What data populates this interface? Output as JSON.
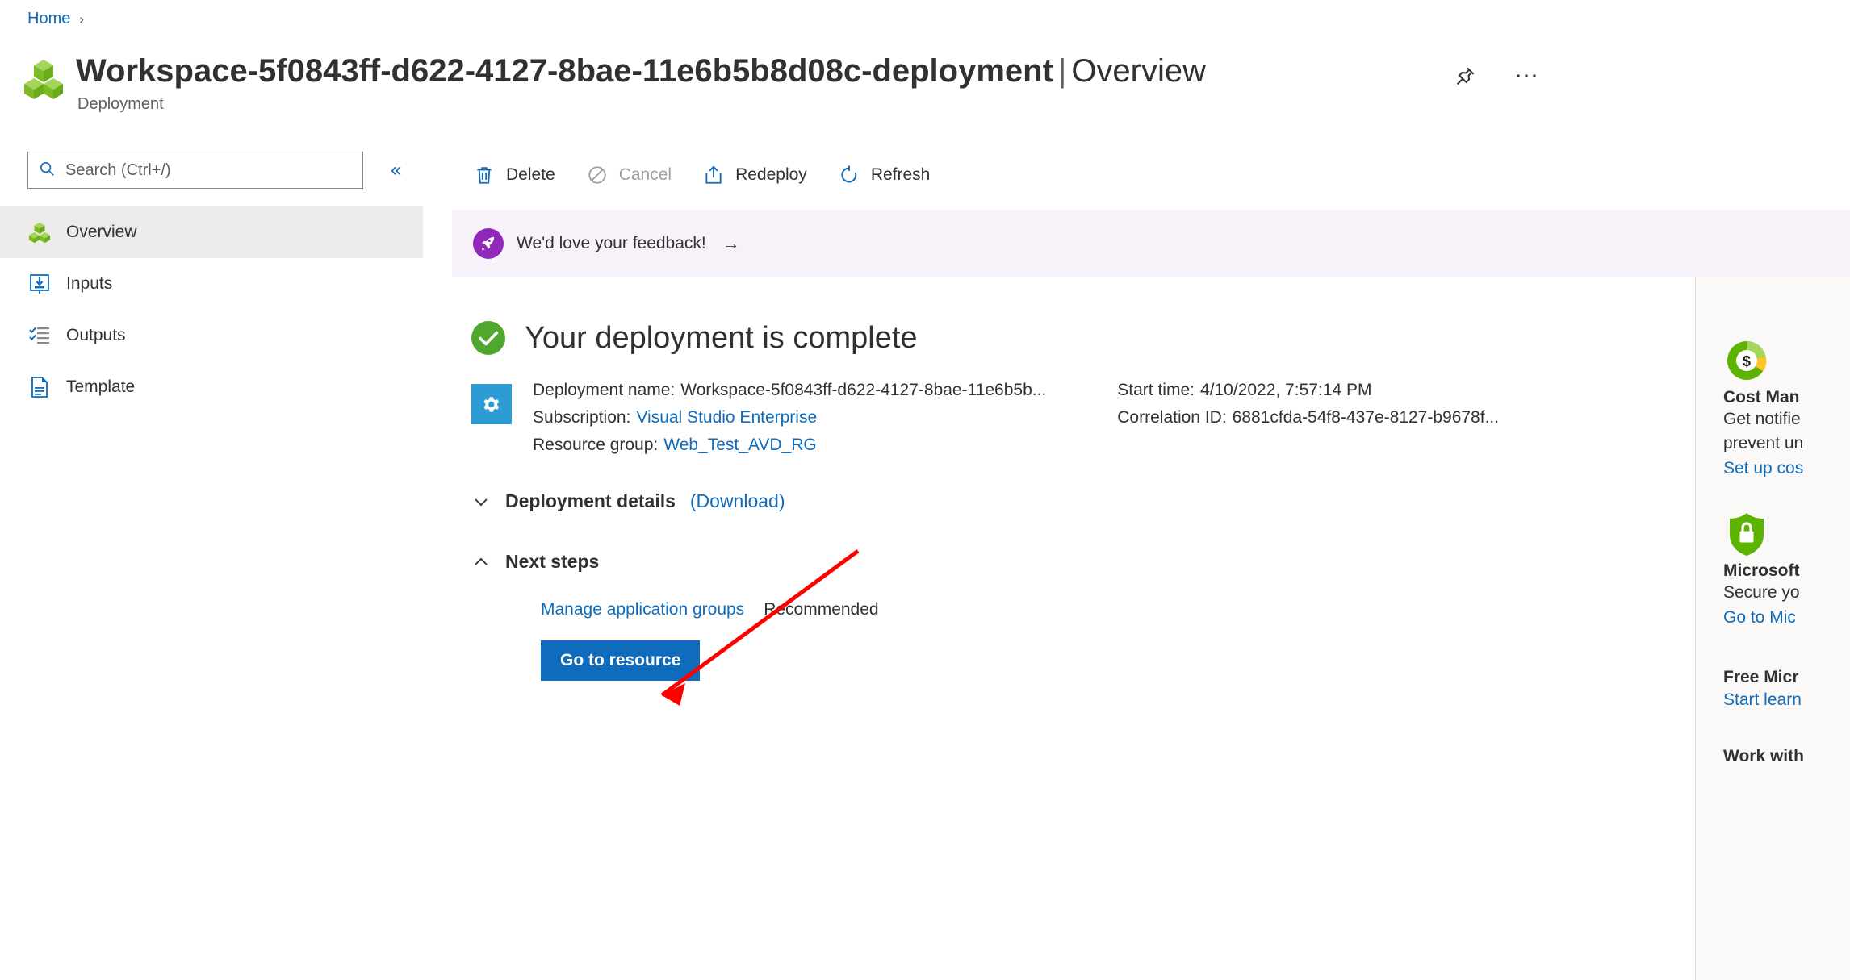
{
  "breadcrumb": {
    "home": "Home",
    "separator": "›"
  },
  "header": {
    "resource_icon": "cubes-icon",
    "title": "Workspace-5f0843ff-d622-4127-8bae-11e6b5b8d08c-deployment",
    "separator": "|",
    "view": "Overview",
    "subtitle": "Deployment",
    "pin_icon": "pin-icon",
    "more_icon": "ellipsis-icon"
  },
  "search": {
    "placeholder": "Search (Ctrl+/)",
    "value": "",
    "icon": "search-icon"
  },
  "collapse": {
    "glyph": "«"
  },
  "sidebar": {
    "items": [
      {
        "label": "Overview",
        "icon": "cubes-icon",
        "selected": true
      },
      {
        "label": "Inputs",
        "icon": "inputs-icon",
        "selected": false
      },
      {
        "label": "Outputs",
        "icon": "outputs-icon",
        "selected": false
      },
      {
        "label": "Template",
        "icon": "document-icon",
        "selected": false
      }
    ]
  },
  "toolbar": {
    "delete": {
      "label": "Delete",
      "icon": "trash-icon",
      "disabled": false
    },
    "cancel": {
      "label": "Cancel",
      "icon": "cancel-icon",
      "disabled": true
    },
    "redeploy": {
      "label": "Redeploy",
      "icon": "upload-icon",
      "disabled": false
    },
    "refresh": {
      "label": "Refresh",
      "icon": "refresh-icon",
      "disabled": false
    }
  },
  "feedback": {
    "text": "We'd love your feedback!",
    "arrow": "→",
    "icon": "rocket-icon"
  },
  "status": {
    "icon": "check-circle-icon",
    "title": "Your deployment is complete"
  },
  "details": {
    "icon": "deployment-icon",
    "deployment_name_label": "Deployment name:",
    "deployment_name_value": "Workspace-5f0843ff-d622-4127-8bae-11e6b5b...",
    "subscription_label": "Subscription:",
    "subscription_value": "Visual Studio Enterprise",
    "resource_group_label": "Resource group:",
    "resource_group_value": "Web_Test_AVD_RG",
    "start_time_label": "Start time:",
    "start_time_value": "4/10/2022, 7:57:14 PM",
    "correlation_id_label": "Correlation ID:",
    "correlation_id_value": "6881cfda-54f8-437e-8127-b9678f..."
  },
  "deployment_details": {
    "title": "Deployment details",
    "download_label": "(Download)",
    "expanded": false
  },
  "next_steps": {
    "title": "Next steps",
    "expanded": true,
    "link_label": "Manage application groups",
    "tag_label": "Recommended",
    "primary_button": "Go to resource"
  },
  "right_rail": {
    "cards": [
      {
        "icon": "cost-donut-icon",
        "title": "Cost Man",
        "body_lines": [
          "Get notifie",
          "prevent un"
        ],
        "link": "Set up cos"
      },
      {
        "icon": "shield-lock-icon",
        "title": "Microsoft",
        "body_lines": [
          "Secure yo"
        ],
        "link": "Go to Mic"
      },
      {
        "icon": "",
        "title": "Free Micr",
        "body_lines": [],
        "link": "Start learn"
      },
      {
        "icon": "",
        "title": "Work with",
        "body_lines": [],
        "link": ""
      }
    ]
  },
  "annotation": {
    "color": "#ff0000",
    "type": "arrow"
  },
  "colors": {
    "accent": "#0f6cbd",
    "link": "#0f6cbd",
    "success": "#5cb300",
    "feedback_bg": "#f7f2f9",
    "selected_bg": "#edebe9",
    "rail_bg": "#faf9f8"
  }
}
